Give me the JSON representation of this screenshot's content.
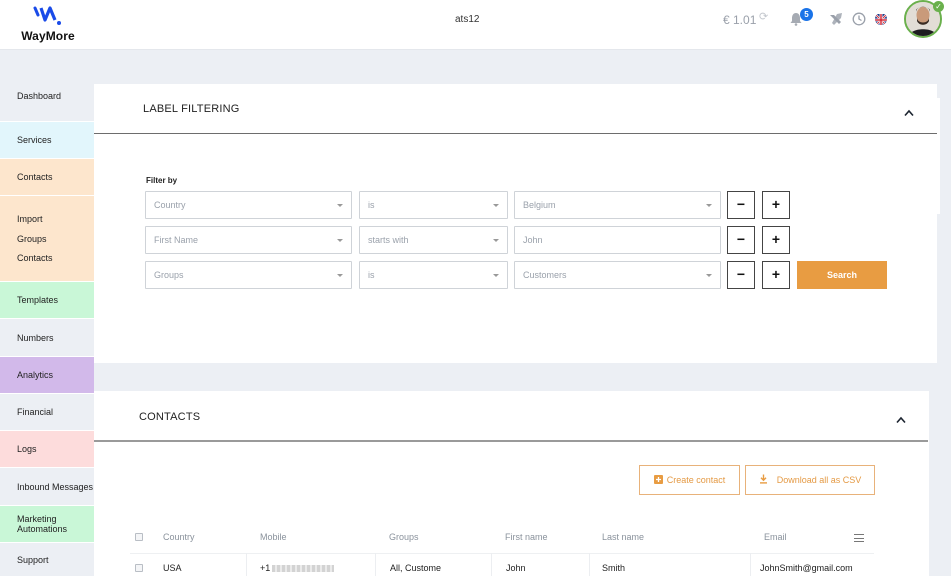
{
  "header": {
    "brand": "WayMore",
    "account_name": "ats12",
    "balance": "€ 1.01",
    "notification_count": "5",
    "language": "en-GB",
    "accent_color": "#1a4be8"
  },
  "sidebar": {
    "items": [
      {
        "label": "Dashboard",
        "color": "#eceff4"
      },
      {
        "label": "Services",
        "color": "#e2f6fc"
      },
      {
        "label": "Contacts",
        "color": "#fde6cd"
      },
      {
        "sub": [
          "Import",
          "Groups",
          "Contacts"
        ],
        "color": "#fde6cd"
      },
      {
        "label": "Templates",
        "color": "#c9f7d7"
      },
      {
        "label": "Numbers",
        "color": "#eceff4"
      },
      {
        "label": "Analytics",
        "color": "#d2b9ea"
      },
      {
        "label": "Financial",
        "color": "#eceff4"
      },
      {
        "label": "Logs",
        "color": "#fddcdc"
      },
      {
        "label": "Inbound Messages",
        "color": "#eceff4"
      },
      {
        "label": "Marketing Automations",
        "color": "#c9f7d7"
      },
      {
        "label": "Support",
        "color": "#eceff4"
      }
    ]
  },
  "label_filtering": {
    "title": "LABEL FILTERING",
    "filter_by_label": "Filter by",
    "rows": [
      {
        "field": "Country",
        "operator": "is",
        "value": "Belgium",
        "value_is_select": true
      },
      {
        "field": "First Name",
        "operator": "starts with",
        "value": "John",
        "value_is_select": false
      },
      {
        "field": "Groups",
        "operator": "is",
        "value": "Customers",
        "value_is_select": true
      }
    ],
    "remove_label": "−",
    "add_label": "+",
    "search_label": "Search",
    "search_color": "#e89c42"
  },
  "contacts": {
    "title": "CONTACTS",
    "create_label": "Create contact",
    "download_label": "Download all as CSV",
    "columns": [
      "Country",
      "Mobile",
      "Groups",
      "First name",
      "Last name",
      "Email"
    ],
    "rows": [
      {
        "country": "USA",
        "mobile_prefix": "+1",
        "groups": "All, Custome",
        "first_name": "John",
        "last_name": "Smith",
        "email": "JohnSmith@gmail.com"
      }
    ]
  }
}
